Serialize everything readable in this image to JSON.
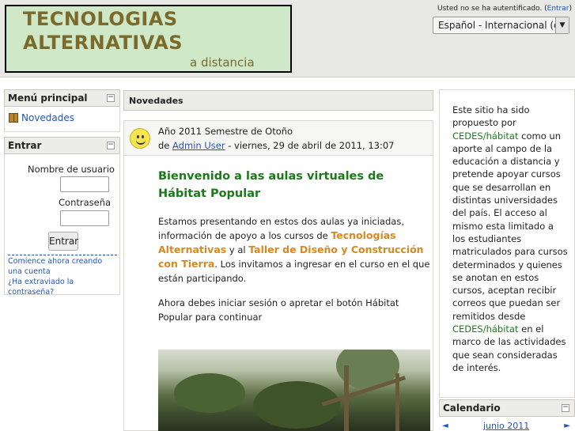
{
  "header": {
    "logo_line1": "TECNOLOGIAS",
    "logo_line2": "ALTERNATIVAS",
    "logo_line3": "a distancia",
    "login_text": "Usted no se ha autentificado. (",
    "login_link": "Entrar",
    "login_close": ")",
    "language": "Español - Internacional (es)"
  },
  "main_menu": {
    "title": "Menú principal",
    "items": [
      {
        "label": "Novedades",
        "icon": "forum-icon"
      }
    ]
  },
  "login_block": {
    "title": "Entrar",
    "username_label": "Nombre de usuario",
    "password_label": "Contraseña",
    "submit_label": "Entrar",
    "signup_link": "Comience ahora creando una cuenta",
    "forgot_link": "¿Ha extraviado la contraseña?"
  },
  "news": {
    "title": "Novedades",
    "post": {
      "subject": "Año 2011 Semestre de Otoño",
      "author_prefix": "de ",
      "author": "Admin User",
      "date": " - viernes, 29 de abril de 2011, 13:07",
      "heading": "Bienvenido a las aulas virtuales de Hábitat Popular",
      "p1_a": "Estamos presentando en estos dos aulas ya iniciadas, información de apoyo a los cursos de ",
      "p1_hl1": "Tecnologías Alternativas",
      "p1_b": " y al ",
      "p1_hl2": "Taller de Diseño y Construcción con Tierra",
      "p1_c": ". Los invitamos a ingresar en el curso en el que están participando.",
      "p2": "Ahora debes iniciar sesión o apretar el botón Hábitat Popular para continuar"
    }
  },
  "sidebar_right": {
    "text_a": "Este sitio ha sido propuesto por ",
    "link1": "CEDES/hábitat",
    "text_b": " como un aporte al campo de la educación a distancia y pretende apoyar cursos que se desarrollan en distintas universidades del país. El acceso al mismo esta limitado a los estudiantes matriculados para cursos determinados y quienes se anotan en estos cursos, aceptan recibir correos que puedan ser remitidos desde ",
    "link2": "CEDES/hábitat",
    "text_c": " en el marco de las actividades que sean consideradas de interés."
  },
  "calendar": {
    "title": "Calendario",
    "prev": "◄",
    "month": "junio 2011",
    "next": "►"
  },
  "colors": {
    "logo_bg": "#cfe8c8",
    "logo_text": "#7a6a2c",
    "heading_green": "#1a7a1a",
    "highlight_orange": "#d88820",
    "link_blue": "#2255bb"
  }
}
